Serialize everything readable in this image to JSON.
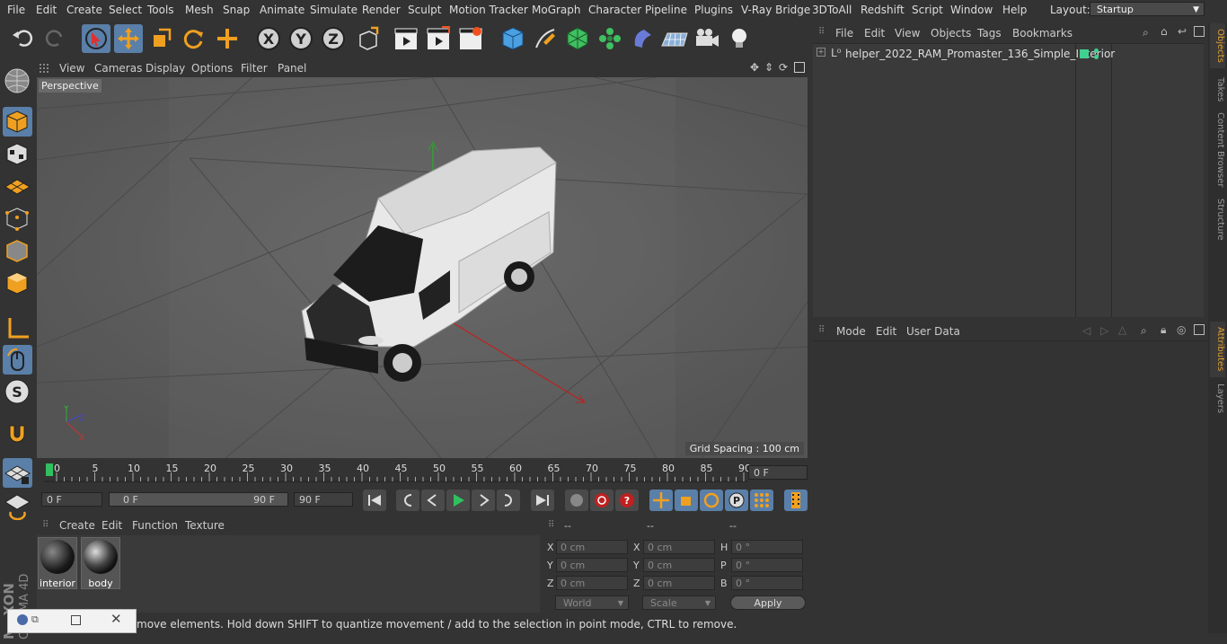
{
  "menubar": {
    "items": [
      "File",
      "Edit",
      "Create",
      "Select",
      "Tools",
      "Mesh",
      "Snap",
      "Animate",
      "Simulate",
      "Render",
      "Sculpt",
      "Motion Tracker",
      "MoGraph",
      "Character",
      "Pipeline",
      "Plugins",
      "V-Ray Bridge",
      "3DToAll",
      "Redshift",
      "Script",
      "Window",
      "Help"
    ],
    "layout_label": "Layout:",
    "layout_value": "Startup"
  },
  "viewport": {
    "menu": [
      "View",
      "Cameras",
      "Display",
      "Options",
      "Filter",
      "Panel"
    ],
    "label": "Perspective",
    "grid_spacing": "Grid Spacing : 100 cm"
  },
  "timeline": {
    "ticks": [
      "0",
      "5",
      "10",
      "15",
      "20",
      "25",
      "30",
      "35",
      "40",
      "45",
      "50",
      "55",
      "60",
      "65",
      "70",
      "75",
      "80",
      "85",
      "90"
    ],
    "current_frame": "0 F",
    "start_field": "0 F",
    "range_start": "0 F",
    "range_end": "90 F",
    "end_field": "90 F"
  },
  "materials": {
    "menu": [
      "Create",
      "Edit",
      "Function",
      "Texture"
    ],
    "items": [
      {
        "name": "interior",
        "color": "#1a1a1a"
      },
      {
        "name": "body",
        "color": "#2a2a2a"
      }
    ]
  },
  "coords": {
    "headers": [
      "--",
      "--",
      "--"
    ],
    "rows": [
      {
        "a": "X",
        "av": "0 cm",
        "b": "X",
        "bv": "0 cm",
        "c": "H",
        "cv": "0 °"
      },
      {
        "a": "Y",
        "av": "0 cm",
        "b": "Y",
        "bv": "0 cm",
        "c": "P",
        "cv": "0 °"
      },
      {
        "a": "Z",
        "av": "0 cm",
        "b": "Z",
        "bv": "0 cm",
        "c": "B",
        "cv": "0 °"
      }
    ],
    "world": "World",
    "scale": "Scale",
    "apply": "Apply"
  },
  "objects": {
    "menu": [
      "File",
      "Edit",
      "View",
      "Objects",
      "Tags",
      "Bookmarks"
    ],
    "tree": [
      {
        "name": "helper_2022_RAM_Promaster_136_Simple_Interior"
      }
    ]
  },
  "attributes": {
    "menu": [
      "Mode",
      "Edit",
      "User Data"
    ]
  },
  "right_tabs": [
    "Objects",
    "Takes",
    "Content Browser",
    "Structure",
    "Attributes",
    "Layers"
  ],
  "status": "move elements. Hold down SHIFT to quantize movement / add to the selection in point mode, CTRL to remove.",
  "brand": "MAXON CINEMA 4D",
  "colors": {
    "accent": "#5a7fa8",
    "orange": "#f0a020",
    "active_tab": "#e0a030"
  }
}
